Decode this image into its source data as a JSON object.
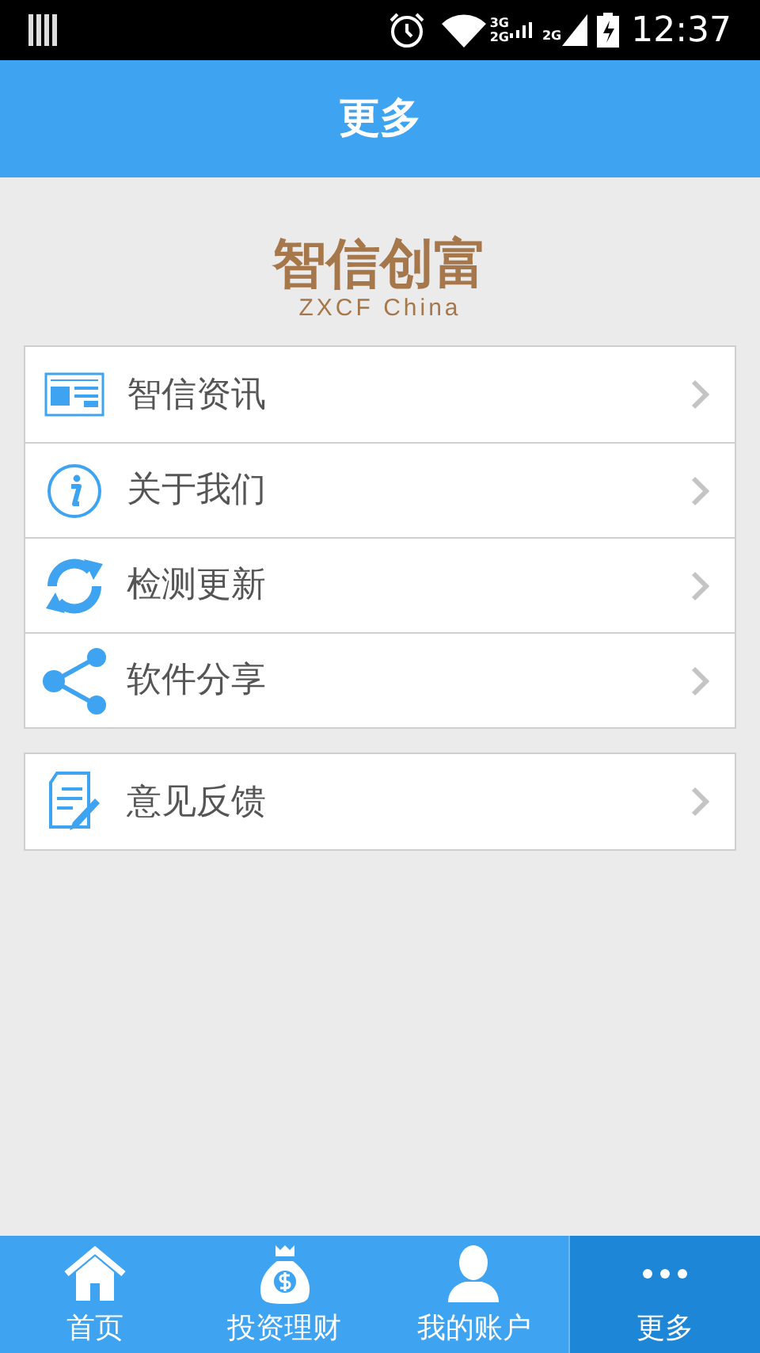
{
  "status_bar": {
    "network_labels": [
      "3G",
      "2G",
      "2G"
    ],
    "time": "12:37"
  },
  "header": {
    "title": "更多"
  },
  "logo": {
    "name": "智信创富",
    "subtitle": "ZXCF China"
  },
  "menu_groups": [
    {
      "items": [
        {
          "kind": "news",
          "label": "智信资讯"
        },
        {
          "kind": "info",
          "label": "关于我们"
        },
        {
          "kind": "refresh",
          "label": "检测更新"
        },
        {
          "kind": "share",
          "label": "软件分享"
        }
      ]
    },
    {
      "items": [
        {
          "kind": "feedback",
          "label": "意见反馈"
        }
      ]
    }
  ],
  "tab_bar": [
    {
      "kind": "home",
      "label": "首页",
      "selected": false
    },
    {
      "kind": "money",
      "label": "投资理财",
      "selected": false
    },
    {
      "kind": "user",
      "label": "我的账户",
      "selected": false
    },
    {
      "kind": "more",
      "label": "更多",
      "selected": true
    }
  ]
}
